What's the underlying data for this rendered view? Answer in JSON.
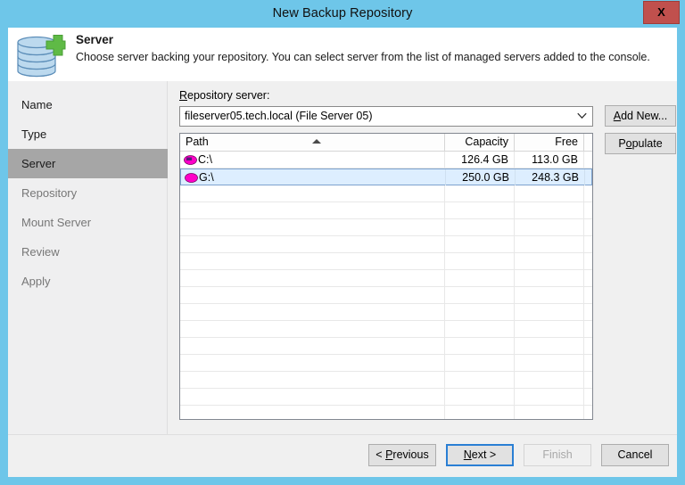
{
  "window": {
    "title": "New Backup Repository",
    "close_label": "X"
  },
  "header": {
    "title": "Server",
    "description": "Choose server backing your repository. You can select server from the list of managed servers added to the console.",
    "icon": "database-add-icon"
  },
  "sidebar": {
    "items": [
      {
        "label": "Name",
        "state": "done"
      },
      {
        "label": "Type",
        "state": "done"
      },
      {
        "label": "Server",
        "state": "active"
      },
      {
        "label": "Repository",
        "state": "pending"
      },
      {
        "label": "Mount Server",
        "state": "pending"
      },
      {
        "label": "Review",
        "state": "pending"
      },
      {
        "label": "Apply",
        "state": "pending"
      }
    ]
  },
  "main": {
    "repository_server_label": "Repository server:",
    "repository_server_label_accel": "R",
    "repository_server_label_rest": "epository server:",
    "repository_server_value": "fileserver05.tech.local (File Server 05)",
    "add_new_label_accel": "A",
    "add_new_label_rest": "dd New...",
    "populate_label_pre": "P",
    "populate_label_accel": "o",
    "populate_label_rest": "pulate",
    "table": {
      "columns": [
        "Path",
        "Capacity",
        "Free"
      ],
      "sort_column": "Path",
      "sort_direction": "ascending",
      "rows": [
        {
          "path": "C:\\",
          "capacity": "126.4 GB",
          "free": "113.0 GB",
          "selected": false,
          "icon": "disk-drive-icon"
        },
        {
          "path": "G:\\",
          "capacity": "250.0 GB",
          "free": "248.3 GB",
          "selected": true,
          "icon": "disk-drive-icon"
        }
      ],
      "empty_row_count": 14
    }
  },
  "footer": {
    "previous_pre": "< ",
    "previous_accel": "P",
    "previous_rest": "revious",
    "next_accel": "N",
    "next_rest": "ext >",
    "finish_label": "Finish",
    "finish_enabled": false,
    "cancel_label": "Cancel"
  },
  "colors": {
    "titlebar": "#6ec6e9",
    "close_button": "#c0504d",
    "sidebar_active": "#a6a6a6",
    "row_selected": "#ddeeff",
    "focus_border": "#2a7fd4",
    "drive_icon": "#ff00c8"
  }
}
